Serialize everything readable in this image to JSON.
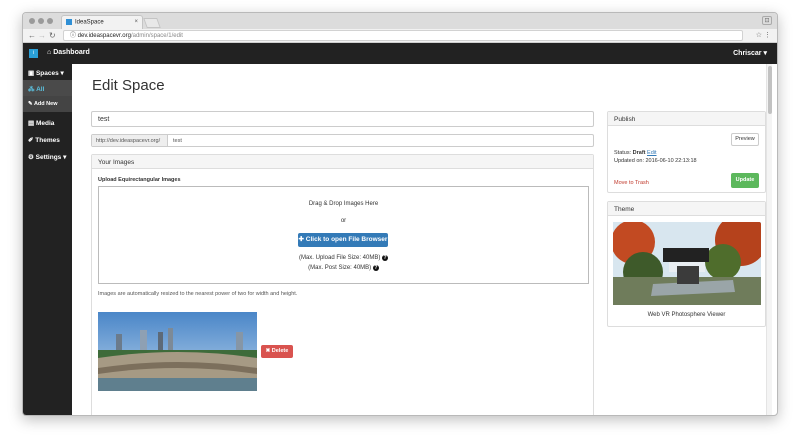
{
  "browser": {
    "tab_title": "IdeaSpace",
    "tab_close": "×",
    "url_host": "dev.ideaspacevr.org",
    "url_path": "/admin/space/1/edit"
  },
  "topnav": {
    "brand": "i",
    "dashboard_label": "Dashboard",
    "user_label": "Chriscar ▾"
  },
  "sidebar": {
    "items": [
      {
        "label": "Spaces ▾"
      },
      {
        "label": "All"
      },
      {
        "label": "Add New"
      },
      {
        "label": "Media"
      },
      {
        "label": "Themes"
      },
      {
        "label": "Settings ▾"
      }
    ]
  },
  "page": {
    "title": "Edit Space",
    "space_title_value": "test",
    "url_prefix": "http://dev.ideaspacevr.org/",
    "url_slug": "test"
  },
  "images_panel": {
    "heading": "Your Images",
    "upload_label": "Upload Equirectangular Images",
    "drag_text": "Drag & Drop Images Here",
    "or_text": "or",
    "browse_label": "✚ Click to open File Browser",
    "max_upload": "(Max. Upload File Size: 40MB)",
    "max_post": "(Max. Post Size: 40MB)",
    "help_glyph": "?",
    "resize_note": "Images are automatically resized to the nearest power of two for width and height.",
    "delete_label": "✖ Delete"
  },
  "publish_panel": {
    "heading": "Publish",
    "preview_label": "Preview",
    "status_label": "Status:",
    "status_value": "Draft",
    "edit_link": "Edit",
    "updated_label": "Updated on: 2016-06-10 22:13:18",
    "trash_label": "Move to Trash",
    "update_label": "Update"
  },
  "theme_panel": {
    "heading": "Theme",
    "theme_name": "Web VR Photosphere Viewer"
  },
  "colors": {
    "nav_bg": "#222222",
    "primary": "#337ab7",
    "danger": "#d9534f",
    "success": "#5cb85c",
    "active": "#5bc0de"
  }
}
